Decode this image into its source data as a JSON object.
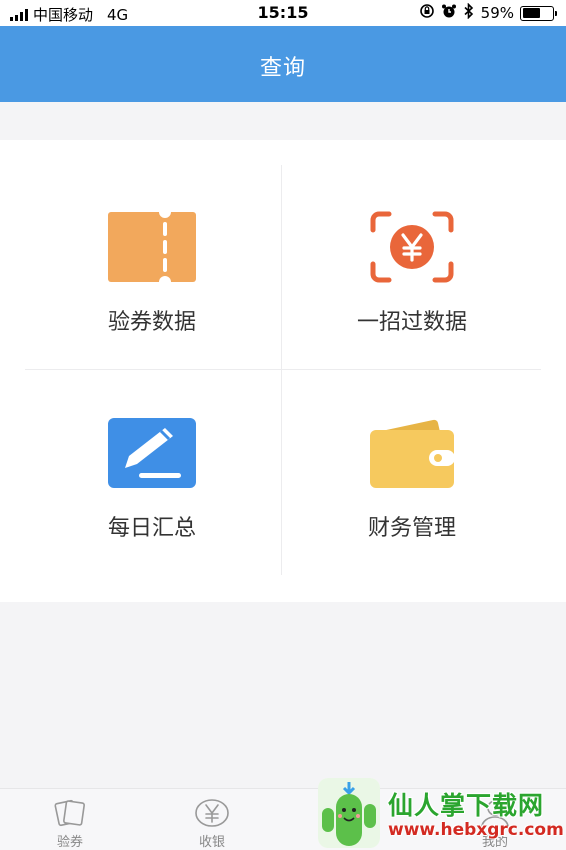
{
  "status_bar": {
    "carrier": "中国移动",
    "network": "4G",
    "time": "15:15",
    "battery": "59%",
    "battery_level": 0.59
  },
  "nav": {
    "title": "查询"
  },
  "grid": [
    {
      "label": "验券数据",
      "icon": "ticket-icon",
      "color": "#f2a85c"
    },
    {
      "label": "一招过数据",
      "icon": "yuan-scan-icon",
      "color": "#e9663a"
    },
    {
      "label": "每日汇总",
      "icon": "edit-icon",
      "color": "#3f8fe6"
    },
    {
      "label": "财务管理",
      "icon": "wallet-icon",
      "color": "#f6c95e"
    }
  ],
  "tab_bar": [
    {
      "label": "验券",
      "icon": "cards-icon"
    },
    {
      "label": "收银",
      "icon": "yuan-circle-icon"
    },
    {
      "label": "我的",
      "icon": "profile-icon"
    }
  ],
  "watermark": {
    "name": "仙人掌下载网",
    "url": "www.hebxgrc.com"
  }
}
